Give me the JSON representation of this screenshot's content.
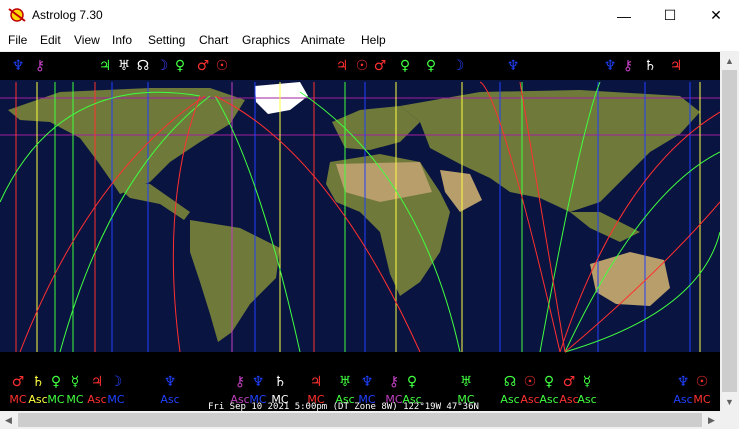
{
  "window": {
    "title": "Astrolog 7.30",
    "controls": {
      "minimize": "—",
      "maximize": "☐",
      "close": "✕"
    }
  },
  "menu": [
    "File",
    "Edit",
    "View",
    "Info",
    "Setting",
    "Chart",
    "Graphics",
    "Animate",
    "Help"
  ],
  "map": {
    "info_line": "Fri Sep 10 2021  5:00pm (DT Zone 8W) 122°19W 47°36N",
    "colors": {
      "ocean": "#0a1440",
      "land": "#6f7a3a",
      "desert": "#b89e6a",
      "ice": "#ffffff"
    },
    "top_glyphs": [
      {
        "g": "♆",
        "c": "#2040ff"
      },
      {
        "g": "⚷",
        "c": "#c040c0"
      },
      {
        "g": "♃",
        "c": "#40ff40"
      },
      {
        "g": "♅",
        "c": "#ffffff"
      },
      {
        "g": "☊",
        "c": "#ffffff"
      },
      {
        "g": "☽",
        "c": "#4040ff"
      },
      {
        "g": "♀",
        "c": "#40ff40"
      },
      {
        "g": "♂",
        "c": "#ff3030"
      },
      {
        "g": "☉",
        "c": "#ff3030"
      },
      {
        "g": "♃",
        "c": "#ff3030"
      },
      {
        "g": "☉",
        "c": "#ff3030"
      },
      {
        "g": "♂",
        "c": "#ff3030"
      },
      {
        "g": "♀",
        "c": "#40ff40"
      },
      {
        "g": "♀",
        "c": "#40ff40"
      },
      {
        "g": "☽",
        "c": "#2040ff"
      },
      {
        "g": "♆",
        "c": "#2040ff"
      },
      {
        "g": "♆",
        "c": "#2040ff"
      },
      {
        "g": "⚷",
        "c": "#c040c0"
      },
      {
        "g": "♄",
        "c": "#ffffff"
      },
      {
        "g": "♃",
        "c": "#ff3030"
      }
    ],
    "bottom_glyphs": [
      {
        "g": "♂",
        "c": "#ff3030"
      },
      {
        "g": "♄",
        "c": "#ffff40"
      },
      {
        "g": "♀",
        "c": "#40ff40"
      },
      {
        "g": "☿",
        "c": "#40ff40"
      },
      {
        "g": "♃",
        "c": "#ff3030"
      },
      {
        "g": "☽",
        "c": "#2040ff"
      },
      {
        "g": "♆",
        "c": "#2040ff"
      },
      {
        "g": "⚷",
        "c": "#c040c0"
      },
      {
        "g": "♆",
        "c": "#2040ff"
      },
      {
        "g": "♄",
        "c": "#ffffff"
      },
      {
        "g": "♃",
        "c": "#ff3030"
      },
      {
        "g": "♅",
        "c": "#40ff40"
      },
      {
        "g": "♆",
        "c": "#2040ff"
      },
      {
        "g": "⚷",
        "c": "#c040c0"
      },
      {
        "g": "♀",
        "c": "#40ff40"
      },
      {
        "g": "♅",
        "c": "#40ff40"
      },
      {
        "g": "☊",
        "c": "#40ff40"
      },
      {
        "g": "☉",
        "c": "#ff3030"
      },
      {
        "g": "♀",
        "c": "#40ff40"
      },
      {
        "g": "♂",
        "c": "#ff3030"
      },
      {
        "g": "☿",
        "c": "#40ff40"
      },
      {
        "g": "♆",
        "c": "#2040ff"
      },
      {
        "g": "☉",
        "c": "#ff3030"
      }
    ],
    "bottom_labels": [
      {
        "t": "MC",
        "c": "#ff3030"
      },
      {
        "t": "Asc",
        "c": "#ffff40"
      },
      {
        "t": "MC",
        "c": "#40ff40"
      },
      {
        "t": "MC",
        "c": "#40ff40"
      },
      {
        "t": "Asc",
        "c": "#ff3030"
      },
      {
        "t": "MC",
        "c": "#2040ff"
      },
      {
        "t": "Asc",
        "c": "#2040ff"
      },
      {
        "t": "Asc",
        "c": "#c040c0"
      },
      {
        "t": "MC",
        "c": "#2040ff"
      },
      {
        "t": "MC",
        "c": "#ffffff"
      },
      {
        "t": "MC",
        "c": "#ff3030"
      },
      {
        "t": "Asc",
        "c": "#40ff40"
      },
      {
        "t": "MC",
        "c": "#2040ff"
      },
      {
        "t": "MC",
        "c": "#c040c0"
      },
      {
        "t": "Asc",
        "c": "#40ff40"
      },
      {
        "t": "MC",
        "c": "#40ff40"
      },
      {
        "t": "Asc",
        "c": "#40ff40"
      },
      {
        "t": "Asc",
        "c": "#ff3030"
      },
      {
        "t": "Asc",
        "c": "#40ff40"
      },
      {
        "t": "Asc",
        "c": "#ff3030"
      },
      {
        "t": "Asc",
        "c": "#40ff40"
      },
      {
        "t": "Asc",
        "c": "#2040ff"
      },
      {
        "t": "MC",
        "c": "#ff3030"
      }
    ]
  }
}
